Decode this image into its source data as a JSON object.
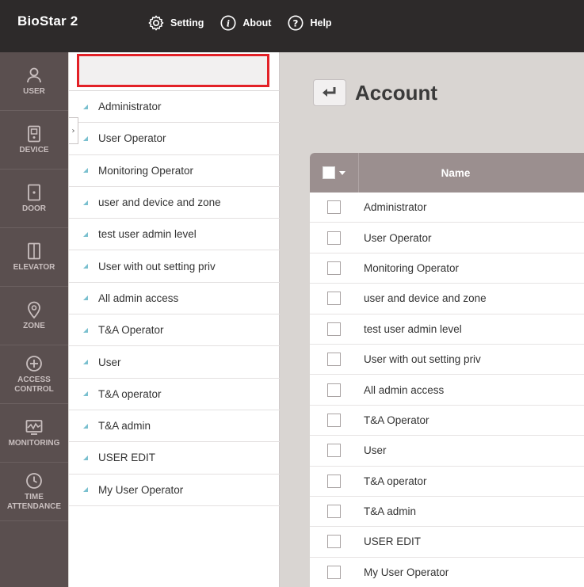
{
  "app": {
    "brand": "BioStar 2"
  },
  "topnav": [
    {
      "label": "Setting",
      "icon": "gear-icon"
    },
    {
      "label": "About",
      "icon": "info-icon"
    },
    {
      "label": "Help",
      "icon": "help-icon"
    }
  ],
  "sidebar": {
    "items": [
      {
        "label": "USER",
        "icon": "user-icon"
      },
      {
        "label": "DEVICE",
        "icon": "device-icon"
      },
      {
        "label": "DOOR",
        "icon": "door-icon"
      },
      {
        "label": "ELEVATOR",
        "icon": "elevator-icon"
      },
      {
        "label": "ZONE",
        "icon": "zone-icon"
      },
      {
        "label": "ACCESS\nCONTROL",
        "icon": "access-control-icon"
      },
      {
        "label": "MONITORING",
        "icon": "monitoring-icon"
      },
      {
        "label": "TIME\nATTENDANCE",
        "icon": "time-attendance-icon"
      }
    ]
  },
  "list": {
    "items": [
      "Administrator",
      "User Operator",
      "Monitoring Operator",
      "user and device and zone",
      "test user admin level",
      "User with out setting priv",
      "All admin access",
      "T&A Operator",
      "User",
      "T&A operator",
      "T&A admin",
      "USER EDIT",
      "My User Operator"
    ]
  },
  "main": {
    "title": "Account",
    "table": {
      "header_name": "Name",
      "rows": [
        "Administrator",
        "User Operator",
        "Monitoring Operator",
        "user and device and zone",
        "test user admin level",
        "User with out setting priv",
        "All admin access",
        "T&A Operator",
        "User",
        "T&A operator",
        "T&A admin",
        "USER EDIT",
        "My User Operator"
      ]
    }
  },
  "colors": {
    "topbar": "#2d2a2a",
    "sidebar": "#5a4f4f",
    "table_header": "#9b8f8f",
    "highlight_border": "#e32127",
    "list_marker": "#7ac0cf"
  }
}
